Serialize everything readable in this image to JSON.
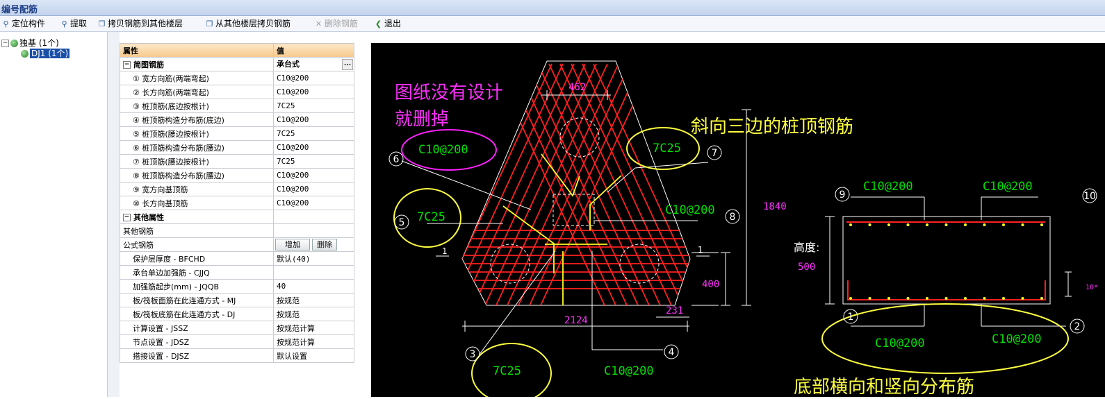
{
  "window": {
    "title": "编号配筋"
  },
  "toolbar": {
    "locate": "定位构件",
    "extract": "提取",
    "copy_to": "拷贝钢筋到其他楼层",
    "copy_from": "从其他楼层拷贝钢筋",
    "delete": "删除钢筋",
    "exit": "退出"
  },
  "tree": {
    "root": "独基 (1个)",
    "child": "DJ1 (1个)"
  },
  "props": {
    "header_name": "属性",
    "header_value": "值",
    "group1": {
      "name": "简图钢筋",
      "value": "承台式"
    },
    "rows1": [
      {
        "name": "① 宽方向筋(两端弯起)",
        "value": "C10@200"
      },
      {
        "name": "② 长方向筋(两端弯起)",
        "value": "C10@200"
      },
      {
        "name": "③ 桩顶筋(底边按根计)",
        "value": "7C25"
      },
      {
        "name": "④ 桩顶筋构造分布筋(底边)",
        "value": "C10@200"
      },
      {
        "name": "⑤ 桩顶筋(腰边按根计)",
        "value": "7C25"
      },
      {
        "name": "⑥ 桩顶筋构造分布筋(腰边)",
        "value": "C10@200"
      },
      {
        "name": "⑦ 桩顶筋(腰边按根计)",
        "value": "7C25"
      },
      {
        "name": "⑧ 桩顶筋构造分布筋(腰边)",
        "value": "C10@200"
      },
      {
        "name": "⑨ 宽方向基顶筋",
        "value": "C10@200"
      },
      {
        "name": "⑩ 长方向基顶筋",
        "value": "C10@200"
      }
    ],
    "group2": {
      "name": "其他属性",
      "value": ""
    },
    "other_rebar": "其他钢筋",
    "formula_rebar": "公式钢筋",
    "add_button": "增加",
    "delete_button": "删除",
    "rows2": [
      {
        "name": "保护层厚度 - BFCHD",
        "value": "默认(40)"
      },
      {
        "name": "承台单边加强筋 - CJJQ",
        "value": ""
      },
      {
        "name": "加强筋起步(mm) - JQQB",
        "value": "40"
      },
      {
        "name": "板/筏板面筋在此连通方式 - MJ",
        "value": "按规范"
      },
      {
        "name": "板/筏板底筋在此连通方式 - DJ",
        "value": "按规范"
      },
      {
        "name": "计算设置 - JSSZ",
        "value": "按规范计算"
      },
      {
        "name": "节点设置 - JDSZ",
        "value": "按规范计算"
      },
      {
        "name": "搭接设置 - DJSZ",
        "value": "默认设置"
      }
    ]
  },
  "drawing": {
    "annotation_delete": [
      "图纸没有设计",
      "就删掉"
    ],
    "annotation_pile_top": "斜向三边的桩顶钢筋",
    "annotation_bottom": "底部横向和竖向分布筋",
    "labels": {
      "l6": "C10@200",
      "l7": "7C25",
      "l5": "7C25",
      "l8": "C10@200",
      "l3": "7C25",
      "l4": "C10@200",
      "l9": "C10@200",
      "l10": "C10@200",
      "l1": "C10@200",
      "l2": "C10@200"
    },
    "dims": {
      "top": "462",
      "width": "2124",
      "corner": "231",
      "height": "1840",
      "depth": "400",
      "section_height": "500",
      "section_label": "高度:",
      "section_offset": "10*",
      "section_mark": "1"
    },
    "nums": {
      "n1": "1",
      "n2": "2",
      "n3": "3",
      "n4": "4",
      "n5": "5",
      "n6": "6",
      "n7": "7",
      "n8": "8",
      "n9": "9",
      "n10": "10"
    },
    "colors": {
      "rebar_red": "#ff2020",
      "rebar_yellow": "#ffff20",
      "label_green": "#00e000",
      "dim_pink": "#ff30ff",
      "outline": "#ffffff",
      "highlight_yellow": "#ffff40",
      "highlight_magenta": "#ff20ff"
    }
  }
}
